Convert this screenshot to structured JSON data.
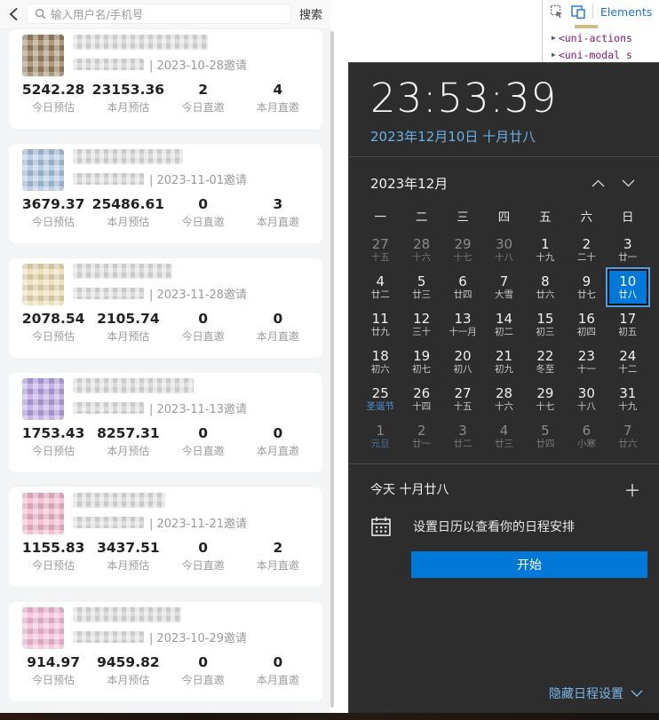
{
  "app": {
    "topbar": {
      "search_placeholder": "输入用户名/手机号",
      "search_button": "搜索"
    },
    "stat_labels": [
      "今日预估",
      "本月预估",
      "今日直邀",
      "本月直邀"
    ],
    "users": [
      {
        "invited": "| 2023-10-28邀请",
        "avatar_color": "#97805f",
        "stats": [
          "5242.28",
          "23153.36",
          "2",
          "4"
        ]
      },
      {
        "invited": "| 2023-11-01邀请",
        "avatar_color": "#a9c2de",
        "stats": [
          "3679.37",
          "25486.61",
          "0",
          "3"
        ]
      },
      {
        "invited": "| 2023-11-28邀请",
        "avatar_color": "#e9d9ae",
        "stats": [
          "2078.54",
          "2105.74",
          "0",
          "0"
        ]
      },
      {
        "invited": "| 2023-11-13邀请",
        "avatar_color": "#b6a1e0",
        "stats": [
          "1753.43",
          "8257.31",
          "0",
          "0"
        ]
      },
      {
        "invited": "| 2023-11-21邀请",
        "avatar_color": "#f0b3c9",
        "stats": [
          "1155.83",
          "3437.51",
          "0",
          "2"
        ]
      },
      {
        "invited": "| 2023-10-29邀请",
        "avatar_color": "#f3bad6",
        "stats": [
          "914.97",
          "9459.82",
          "0",
          "0"
        ]
      }
    ]
  },
  "devtools": {
    "tab": "Elements",
    "code_lines": [
      "<uni-actions",
      "<uni-modal s"
    ],
    "tab_color": "#1a73e8",
    "tag_color": "#881280"
  },
  "flyout": {
    "time": "23:53:39",
    "date": "2023年12月10日 十月廿八",
    "month_label": "2023年12月",
    "weekdays": [
      "一",
      "二",
      "三",
      "四",
      "五",
      "六",
      "日"
    ],
    "cells": [
      {
        "d": "27",
        "l": "十五",
        "dim": true
      },
      {
        "d": "28",
        "l": "十六",
        "dim": true
      },
      {
        "d": "29",
        "l": "十七",
        "dim": true
      },
      {
        "d": "30",
        "l": "十八",
        "dim": true
      },
      {
        "d": "1",
        "l": "十九"
      },
      {
        "d": "2",
        "l": "二十"
      },
      {
        "d": "3",
        "l": "廿一"
      },
      {
        "d": "4",
        "l": "廿二"
      },
      {
        "d": "5",
        "l": "廿三"
      },
      {
        "d": "6",
        "l": "廿四"
      },
      {
        "d": "7",
        "l": "大雪"
      },
      {
        "d": "8",
        "l": "廿六"
      },
      {
        "d": "9",
        "l": "廿七"
      },
      {
        "d": "10",
        "l": "廿八",
        "sel": true
      },
      {
        "d": "11",
        "l": "廿九"
      },
      {
        "d": "12",
        "l": "三十"
      },
      {
        "d": "13",
        "l": "十一月"
      },
      {
        "d": "14",
        "l": "初二"
      },
      {
        "d": "15",
        "l": "初三"
      },
      {
        "d": "16",
        "l": "初四"
      },
      {
        "d": "17",
        "l": "初五"
      },
      {
        "d": "18",
        "l": "初六"
      },
      {
        "d": "19",
        "l": "初七"
      },
      {
        "d": "20",
        "l": "初八"
      },
      {
        "d": "21",
        "l": "初九"
      },
      {
        "d": "22",
        "l": "冬至"
      },
      {
        "d": "23",
        "l": "十一"
      },
      {
        "d": "24",
        "l": "十二"
      },
      {
        "d": "25",
        "l": "圣诞节",
        "holiday": true
      },
      {
        "d": "26",
        "l": "十四"
      },
      {
        "d": "27",
        "l": "十五"
      },
      {
        "d": "28",
        "l": "十六"
      },
      {
        "d": "29",
        "l": "十七"
      },
      {
        "d": "30",
        "l": "十八"
      },
      {
        "d": "31",
        "l": "十九"
      },
      {
        "d": "1",
        "l": "元旦",
        "dim": true,
        "holiday": true
      },
      {
        "d": "2",
        "l": "廿一",
        "dim": true
      },
      {
        "d": "3",
        "l": "廿二",
        "dim": true
      },
      {
        "d": "4",
        "l": "廿三",
        "dim": true
      },
      {
        "d": "5",
        "l": "廿四",
        "dim": true
      },
      {
        "d": "6",
        "l": "小寒",
        "dim": true
      },
      {
        "d": "7",
        "l": "廿六",
        "dim": true
      }
    ],
    "today_label": "今天 十月廿八",
    "agenda_hint": "设置日历以查看你的日程安排",
    "start_button": "开始",
    "hide_settings": "隐藏日程设置"
  },
  "colors": {
    "accent": "#0078d7",
    "link_blue": "#79b7ea",
    "date_blue": "#69b0e6"
  }
}
